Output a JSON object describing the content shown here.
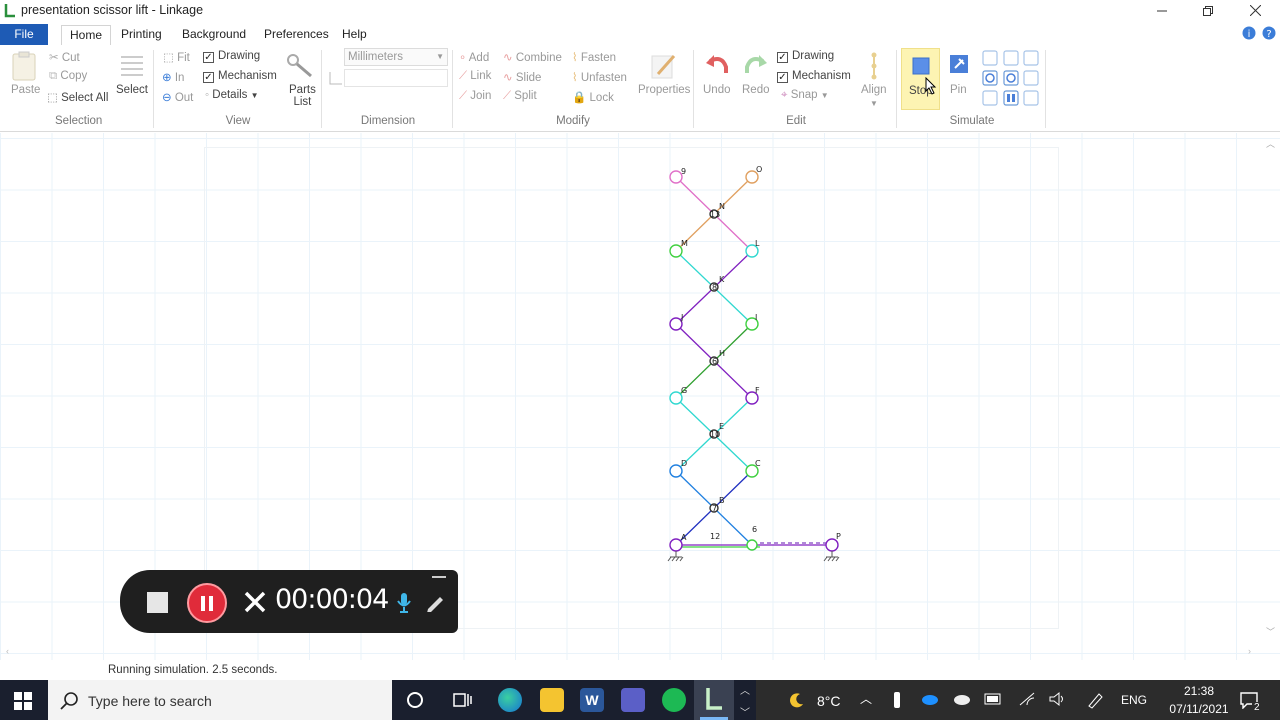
{
  "window": {
    "title": "presentation scissor lift - Linkage",
    "controls": [
      "minimize",
      "restore",
      "close"
    ]
  },
  "menu": {
    "tabs": [
      "File",
      "Home",
      "Printing",
      "Background",
      "Preferences",
      "Help"
    ],
    "active": "Home"
  },
  "ribbon": {
    "selection": {
      "label": "Selection",
      "paste": "Paste",
      "cut": "Cut",
      "copy": "Copy",
      "select_all": "Select All",
      "select": "Select"
    },
    "view": {
      "label": "View",
      "fit": "Fit",
      "zoom_in": "In",
      "zoom_out": "Out",
      "drawing": "Drawing",
      "mechanism": "Mechanism",
      "details": "Details",
      "drawing_checked": true,
      "mechanism_checked": true,
      "parts_list_1": "Parts",
      "parts_list_2": "List"
    },
    "dimension": {
      "label": "Dimension",
      "units": "Millimeters"
    },
    "modify": {
      "label": "Modify",
      "add": "Add",
      "link": "Link",
      "join": "Join",
      "combine": "Combine",
      "slide": "Slide",
      "split": "Split",
      "fasten": "Fasten",
      "unfasten": "Unfasten",
      "lock": "Lock",
      "properties": "Properties"
    },
    "edit": {
      "label": "Edit",
      "undo": "Undo",
      "redo": "Redo",
      "drawing": "Drawing",
      "mechanism": "Mechanism",
      "snap": "Snap",
      "drawing_checked": true,
      "mechanism_checked": true,
      "align": "Align"
    },
    "simulate": {
      "label": "Simulate",
      "stop": "Stop",
      "pin": "Pin"
    }
  },
  "mechanism_labels": [
    "9",
    "O",
    "N",
    "13",
    "M",
    "L",
    "K",
    "8",
    "J",
    "I",
    "H",
    "6",
    "G",
    "F",
    "E",
    "10",
    "D",
    "C",
    "B",
    "7",
    "A",
    "12",
    "6",
    "P"
  ],
  "recorder": {
    "timer": "00:00:04"
  },
  "status": {
    "text": "Running simulation. 2.5 seconds."
  },
  "taskbar": {
    "search_placeholder": "Type here to search",
    "weather": "8°C",
    "language": "ENG",
    "time": "21:38",
    "date": "07/11/2021",
    "notifications": "2"
  }
}
